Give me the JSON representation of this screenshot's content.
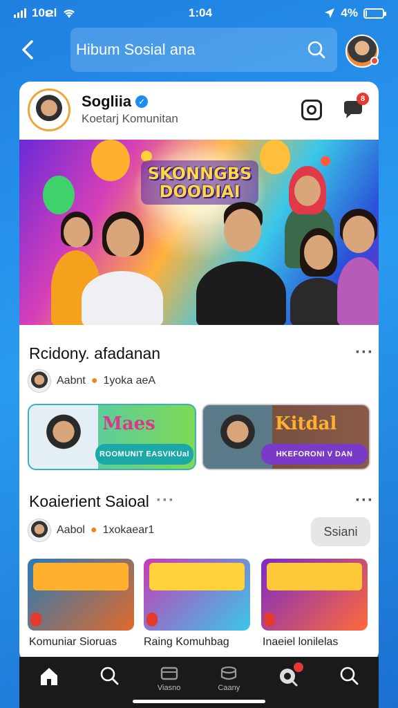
{
  "status_bar": {
    "signal_label": "10ຂl",
    "time": "1:04",
    "battery": "4%",
    "battery_level": 0.04
  },
  "search": {
    "value": "Hibum Sosial ana"
  },
  "profile": {
    "name": "Sogliia",
    "subtitle": "Koetarj Komunitan",
    "notification_count": "8"
  },
  "hero": {
    "title": "SKONNGBS DOODIAI",
    "slide_count": 4,
    "active_slide": 1
  },
  "section1": {
    "title": "Rcidony. afadanan",
    "creator": "Aabnt",
    "creator_tag": "1yoka aeA",
    "promos": [
      {
        "headline": "Maes",
        "button": "ROOMUNIT EASVIKUal"
      },
      {
        "headline": "Kitdal",
        "button": "HKEFORONI V DAN"
      }
    ]
  },
  "section2": {
    "title": "Koaierient Saioal",
    "creator": "Aabol",
    "creator_tag": "1xokaear1",
    "action_label": "Ssiani",
    "thumbnails": [
      {
        "label": "Komuniar Sioruas"
      },
      {
        "label": "Raing Komuhbag"
      },
      {
        "label": "Inaeiel lonilelas"
      }
    ]
  },
  "nav": {
    "items": [
      {
        "label": ""
      },
      {
        "label": ""
      },
      {
        "label": "Viasno"
      },
      {
        "label": "Caany"
      },
      {
        "label": ""
      },
      {
        "label": ""
      }
    ]
  },
  "colors": {
    "accent": "#1d8cf0",
    "badge": "#e53935",
    "flame": "#f0861a",
    "nav_bg": "#1a1a1a"
  }
}
